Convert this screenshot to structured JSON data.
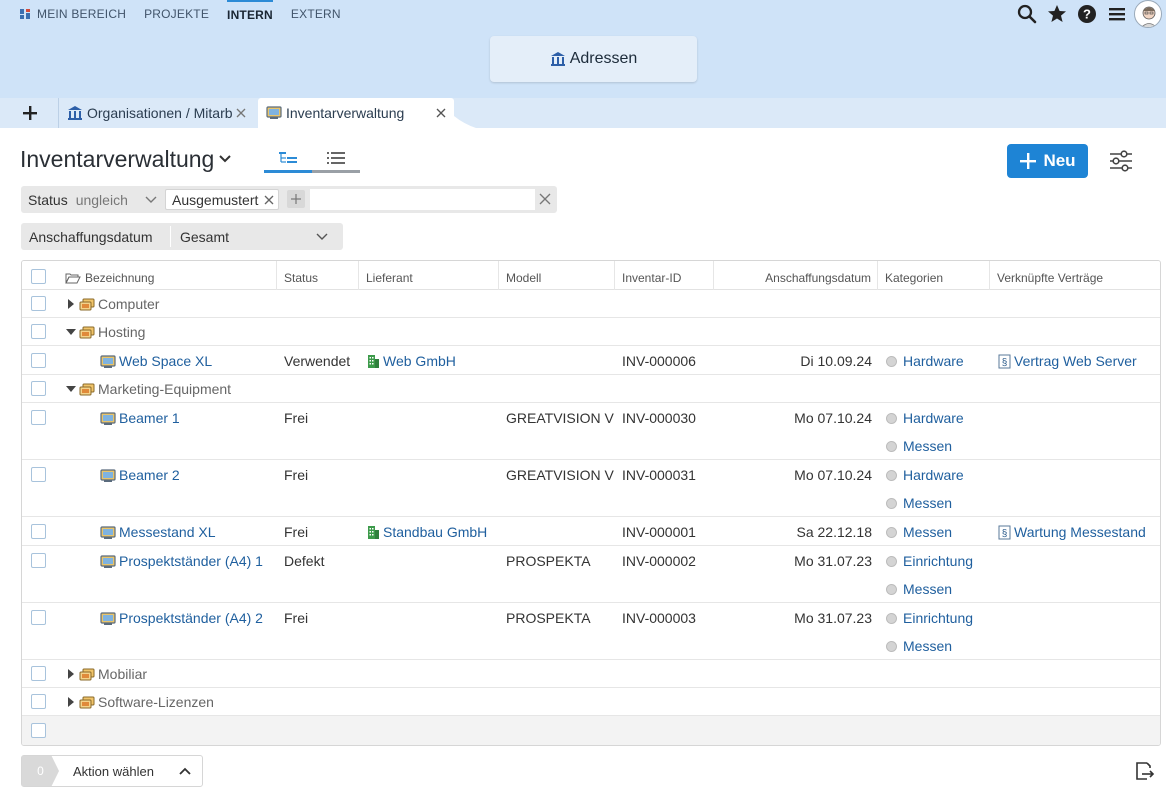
{
  "topnav": {
    "items": [
      "MEIN BEREICH",
      "PROJEKTE",
      "INTERN",
      "EXTERN"
    ],
    "active": "INTERN"
  },
  "topicons": [
    "search-icon",
    "star-icon",
    "help-icon",
    "menu-icon",
    "avatar"
  ],
  "page_tab": {
    "label": "Adressen",
    "icon": "building-icon"
  },
  "tabs": [
    {
      "label": "Organisationen / Mitarbeiter",
      "icon": "building-icon"
    },
    {
      "label": "Inventarverwaltung",
      "icon": "inventory-icon"
    }
  ],
  "header": {
    "title": "Inventarverwaltung",
    "new_button": "Neu"
  },
  "filters": {
    "status_key": "Status",
    "status_op": "ungleich",
    "status_value": "Ausgemustert",
    "date_key": "Anschaffungsdatum",
    "date_value": "Gesamt"
  },
  "columns": [
    "Bezeichnung",
    "Status",
    "Lieferant",
    "Modell",
    "Inventar-ID",
    "Anschaffungsdatum",
    "Kategorien",
    "Verknüpfte Verträge"
  ],
  "rows": [
    {
      "name": "Computer"
    },
    {
      "name": "Hosting"
    },
    {
      "name": "Web Space XL",
      "status": "Verwendet",
      "supplier": "Web GmbH",
      "model": "",
      "id": "INV-000006",
      "date": "Di 10.09.24",
      "cats": [
        "Hardware"
      ],
      "contract": "Vertrag Web Server"
    },
    {
      "name": "Marketing-Equipment"
    },
    {
      "name": "Beamer 1",
      "status": "Frei",
      "supplier": "",
      "model": "GREATVISION V",
      "id": "INV-000030",
      "date": "Mo 07.10.24",
      "cats": [
        "Hardware",
        "Messen"
      ],
      "contract": ""
    },
    {
      "name": "Beamer 2",
      "status": "Frei",
      "supplier": "",
      "model": "GREATVISION V",
      "id": "INV-000031",
      "date": "Mo 07.10.24",
      "cats": [
        "Hardware",
        "Messen"
      ],
      "contract": ""
    },
    {
      "name": "Messestand XL",
      "status": "Frei",
      "supplier": "Standbau GmbH",
      "model": "",
      "id": "INV-000001",
      "date": "Sa 22.12.18",
      "cats": [
        "Messen"
      ],
      "contract": "Wartung Messestand"
    },
    {
      "name": "Prospektständer (A4) 1",
      "status": "Defekt",
      "supplier": "",
      "model": "PROSPEKTA",
      "id": "INV-000002",
      "date": "Mo 31.07.23",
      "cats": [
        "Einrichtung",
        "Messen"
      ],
      "contract": ""
    },
    {
      "name": "Prospektständer (A4) 2",
      "status": "Frei",
      "supplier": "",
      "model": "PROSPEKTA",
      "id": "INV-000003",
      "date": "Mo 31.07.23",
      "cats": [
        "Einrichtung",
        "Messen"
      ],
      "contract": ""
    },
    {
      "name": "Mobiliar"
    },
    {
      "name": "Software-Lizenzen"
    }
  ],
  "footer": {
    "selected_count": "0",
    "action_label": "Aktion wählen"
  },
  "colors": {
    "accent": "#1e84d5",
    "topbar": "#cfe3f8",
    "link": "#1f5f9e"
  }
}
